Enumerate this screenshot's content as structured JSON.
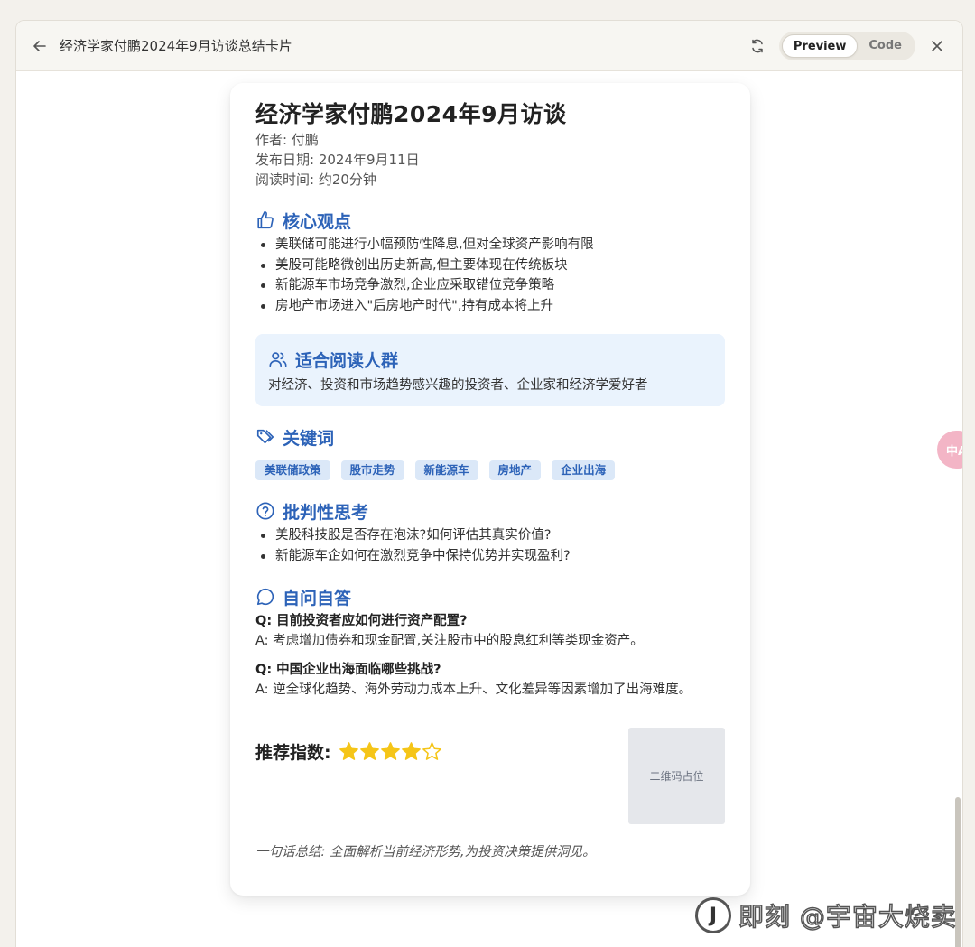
{
  "window": {
    "title": "经济学家付鹏2024年9月访谈总结卡片",
    "tabs": [
      {
        "label": "Preview",
        "active": true
      },
      {
        "label": "Code",
        "active": false
      }
    ]
  },
  "card": {
    "title": "经济学家付鹏2024年9月访谈",
    "author": "作者: 付鹏",
    "date": "发布日期: 2024年9月11日",
    "reading_time": "阅读时间: 约20分钟",
    "core_views": {
      "heading": "核心观点",
      "icon": "thumbs-up-icon",
      "items": [
        "美联储可能进行小幅预防性降息,但对全球资产影响有限",
        "美股可能略微创出历史新高,但主要体现在传统板块",
        "新能源车市场竞争激烈,企业应采取错位竞争策略",
        "房地产市场进入\"后房地产时代\",持有成本将上升"
      ]
    },
    "audience": {
      "heading": "适合阅读人群",
      "icon": "users-icon",
      "text": "对经济、投资和市场趋势感兴趣的投资者、企业家和经济学爱好者"
    },
    "keywords": {
      "heading": "关键词",
      "icon": "tags-icon",
      "tags": [
        "美联储政策",
        "股市走势",
        "新能源车",
        "房地产",
        "企业出海"
      ]
    },
    "critical": {
      "heading": "批判性思考",
      "icon": "question-circle-icon",
      "items": [
        "美股科技股是否存在泡沫?如何评估其真实价值?",
        "新能源车企如何在激烈竞争中保持优势并实现盈利?"
      ]
    },
    "qa": {
      "heading": "自问自答",
      "icon": "chat-bubble-icon",
      "items": [
        {
          "q": "Q: 目前投资者应如何进行资产配置?",
          "a": "A: 考虑增加债券和现金配置,关注股市中的股息红利等类现金资产。"
        },
        {
          "q": "Q: 中国企业出海面临哪些挑战?",
          "a": "A: 逆全球化趋势、海外劳动力成本上升、文化差异等因素增加了出海难度。"
        }
      ]
    },
    "rating": {
      "label": "推荐指数:",
      "stars": 4,
      "max": 5,
      "color": "#f5c518"
    },
    "qr_placeholder": "二维码占位",
    "summary": "一句话总结: 全面解析当前经济形势,为投资决策提供洞见。"
  },
  "side_tab": "中A",
  "watermark": {
    "logo": "J",
    "text": "即刻 @宇宙大烧卖"
  },
  "colors": {
    "accent": "#2d63b8",
    "audience_bg": "#eaf3fd",
    "tag_bg": "#dbe8f8"
  }
}
